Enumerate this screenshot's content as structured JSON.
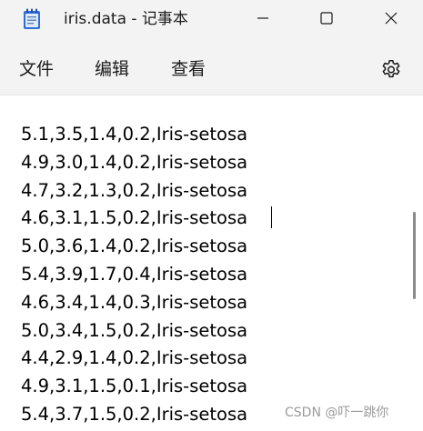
{
  "window": {
    "title": "iris.data - 记事本"
  },
  "menu": {
    "file": "文件",
    "edit": "编辑",
    "view": "查看"
  },
  "icons": {
    "app": "notepad-icon",
    "minimize": "minimize-icon",
    "maximize": "maximize-icon",
    "close": "close-icon",
    "settings": "gear-icon"
  },
  "editor": {
    "lines": [
      "5.1,3.5,1.4,0.2,Iris-setosa",
      "4.9,3.0,1.4,0.2,Iris-setosa",
      "4.7,3.2,1.3,0.2,Iris-setosa",
      "4.6,3.1,1.5,0.2,Iris-setosa",
      "5.0,3.6,1.4,0.2,Iris-setosa",
      "5.4,3.9,1.7,0.4,Iris-setosa",
      "4.6,3.4,1.4,0.3,Iris-setosa",
      "5.0,3.4,1.5,0.2,Iris-setosa",
      "4.4,2.9,1.4,0.2,Iris-setosa",
      "4.9,3.1,1.5,0.1,Iris-setosa",
      "5.4,3.7,1.5,0.2,Iris-setosa"
    ]
  },
  "watermark": "CSDN @吓一跳你",
  "colors": {
    "chrome_background": "#f3f3f3",
    "editor_background": "#ffffff",
    "text": "#000000",
    "icon_blue": "#2f6ed8"
  }
}
